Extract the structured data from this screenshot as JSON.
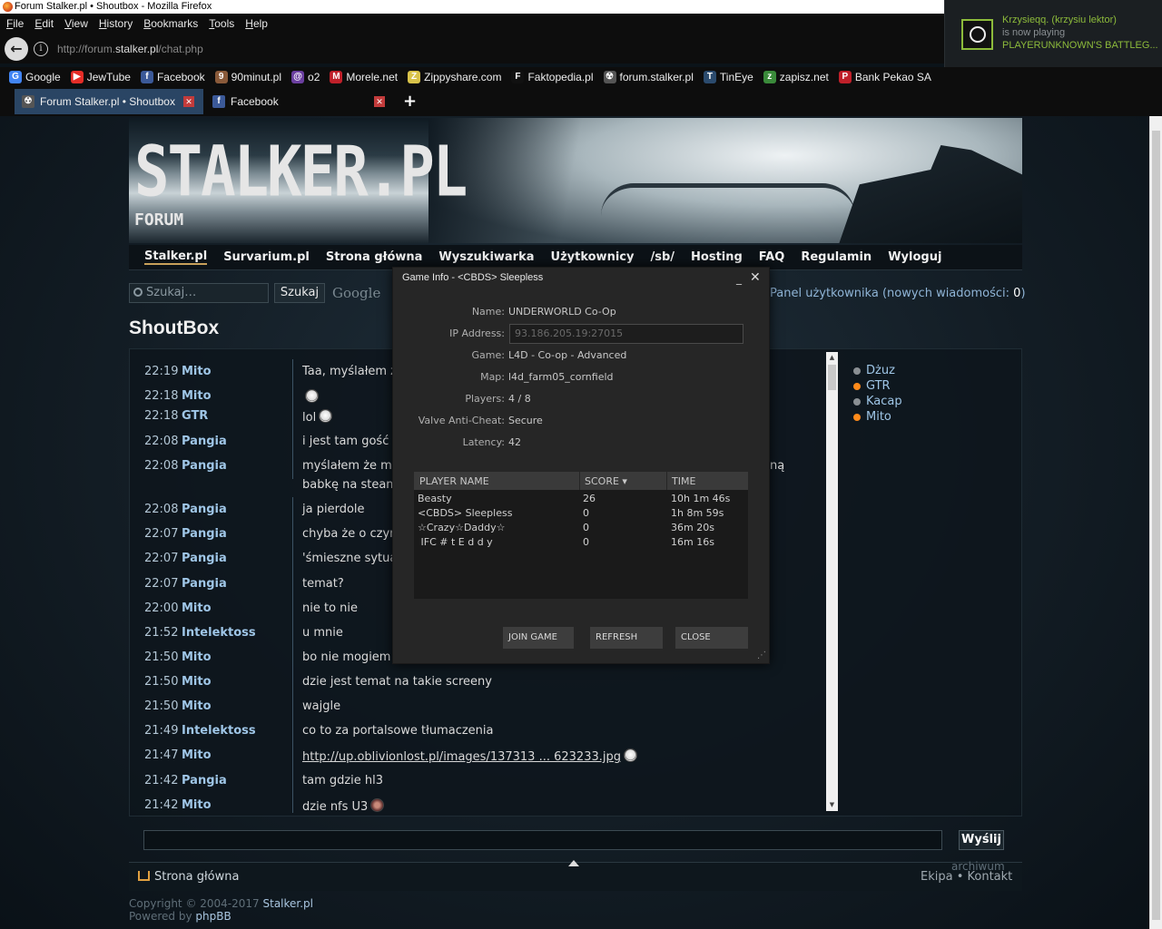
{
  "window": {
    "title": "Forum Stalker.pl • Shoutbox - Mozilla Firefox"
  },
  "menubar": [
    "File",
    "Edit",
    "View",
    "History",
    "Bookmarks",
    "Tools",
    "Help"
  ],
  "address": {
    "prefix": "http://forum.",
    "domain": "stalker.pl",
    "path": "/chat.php"
  },
  "bookmarks": [
    {
      "label": "Google",
      "icon": "google-icon",
      "color": "#4285f4",
      "glyph": "G"
    },
    {
      "label": "JewTube",
      "icon": "youtube-icon",
      "color": "#e52d27",
      "glyph": "▶"
    },
    {
      "label": "Facebook",
      "icon": "facebook-icon",
      "color": "#3b5998",
      "glyph": "f"
    },
    {
      "label": "90minut.pl",
      "icon": "90minut-icon",
      "color": "#8a5a3a",
      "glyph": "9"
    },
    {
      "label": "o2",
      "icon": "o2-icon",
      "color": "#6b3fa0",
      "glyph": "@"
    },
    {
      "label": "Morele.net",
      "icon": "morele-icon",
      "color": "#c0202a",
      "glyph": "M"
    },
    {
      "label": "Zippyshare.com",
      "icon": "zippyshare-icon",
      "color": "#d9c34a",
      "glyph": "Z"
    },
    {
      "label": "Faktopedia.pl",
      "icon": "faktopedia-icon",
      "color": "#111111",
      "glyph": "F"
    },
    {
      "label": "forum.stalker.pl",
      "icon": "radiation-icon",
      "color": "#555555",
      "glyph": "☢"
    },
    {
      "label": "TinEye",
      "icon": "tineye-icon",
      "color": "#2b4b6e",
      "glyph": "T"
    },
    {
      "label": "zapisz.net",
      "icon": "zapisz-icon",
      "color": "#3a8a3a",
      "glyph": "z"
    },
    {
      "label": "Bank Pekao SA",
      "icon": "pekao-icon",
      "color": "#c0202a",
      "glyph": "P"
    }
  ],
  "tabs": [
    {
      "label": "Forum Stalker.pl • Shoutbox",
      "icon": "radiation-icon"
    },
    {
      "label": "Facebook",
      "icon": "facebook-icon"
    }
  ],
  "site": {
    "logo": "STALKER.PL",
    "logo_sub": "FORUM",
    "nav": [
      "Stalker.pl",
      "Survarium.pl",
      "Strona główna",
      "Wyszukiwarka",
      "Użytkownicy",
      "/sb/",
      "Hosting",
      "FAQ",
      "Regulamin",
      "Wyloguj"
    ],
    "search_placeholder": "Szukaj…",
    "search_button": "Szukaj",
    "google": "Google",
    "panel_text": "Panel użytkownika (nowych wiadomości: ",
    "panel_count": "0",
    "panel_end": ")",
    "heading": "ShoutBox"
  },
  "shoutbox": {
    "messages": [
      {
        "time": "22:19",
        "user": "Mito",
        "text": "Taa, myślałem ż",
        "smiley": false
      },
      {
        "time": "22:18",
        "user": "Mito",
        "text": "",
        "smiley": true
      },
      {
        "time": "22:18",
        "user": "GTR",
        "text": "lol",
        "smiley": true
      },
      {
        "time": "22:08",
        "user": "Pangia",
        "text": "i jest tam gość c",
        "smiley": false
      },
      {
        "time": "22:08",
        "user": "Pangia",
        "text": "myślałem że mó",
        "text2": "babkę na steam",
        "tail": "ną",
        "smiley": false
      },
      {
        "time": "22:08",
        "user": "Pangia",
        "text": "ja pierdole",
        "smiley": false
      },
      {
        "time": "22:07",
        "user": "Pangia",
        "text": "chyba że o czym",
        "smiley": false
      },
      {
        "time": "22:07",
        "user": "Pangia",
        "text": "'śmieszne sytua",
        "smiley": false
      },
      {
        "time": "22:07",
        "user": "Pangia",
        "text": "temat?",
        "smiley": false
      },
      {
        "time": "22:00",
        "user": "Mito",
        "text": "nie to nie",
        "smiley": false
      },
      {
        "time": "21:52",
        "user": "Intelektoss",
        "text": "u mnie",
        "smiley": false
      },
      {
        "time": "21:50",
        "user": "Mito",
        "text": "bo nie mogiem z",
        "smiley": false
      },
      {
        "time": "21:50",
        "user": "Mito",
        "text": "dzie jest temat na takie screeny",
        "smiley": false
      },
      {
        "time": "21:50",
        "user": "Mito",
        "text": "wajgle",
        "smiley": false
      },
      {
        "time": "21:49",
        "user": "Intelektoss",
        "text": "co to za portalsowe tłumaczenia",
        "smiley": false
      },
      {
        "time": "21:47",
        "user": "Mito",
        "link": "http://up.oblivionlost.pl/images/137313 ... 623233.jpg",
        "smiley": true
      },
      {
        "time": "21:42",
        "user": "Pangia",
        "text": "tam gdzie hl3",
        "smiley": false
      },
      {
        "time": "21:42",
        "user": "Mito",
        "text": "dzie nfs U3",
        "avatar": true
      }
    ],
    "online_users": [
      {
        "name": "Dżuz",
        "status_color": "#8a8f93"
      },
      {
        "name": "GTR",
        "status_color": "#ff8a1a"
      },
      {
        "name": "Kacap",
        "status_color": "#8a8f93"
      },
      {
        "name": "Mito",
        "status_color": "#ff8a1a"
      }
    ],
    "send_button": "Wyślij",
    "home_link": "Strona główna",
    "archive": "archiwum",
    "footer_right_a": "Ekipa",
    "footer_dot": " • ",
    "footer_right_b": "Kontakt",
    "copyright": "Copyright © 2004-2017 ",
    "copyright_link": "Stalker.pl",
    "powered": "Powered by ",
    "powered_link": "phpBB"
  },
  "dialog": {
    "title": "Game Info - <CBDS> Sleepless",
    "fields": [
      {
        "label": "Name:",
        "value": "UNDERWORLD Co-Op"
      },
      {
        "label": "IP Address:",
        "value": "93.186.205.19:27015"
      },
      {
        "label": "Game:",
        "value": "L4D - Co-op - Advanced"
      },
      {
        "label": "Map:",
        "value": "l4d_farm05_cornfield"
      },
      {
        "label": "Players:",
        "value": "4 / 8"
      },
      {
        "label": "Valve Anti-Cheat:",
        "value": "Secure"
      },
      {
        "label": "Latency:",
        "value": "42"
      }
    ],
    "columns": [
      "PLAYER NAME",
      "SCORE ▾",
      "TIME"
    ],
    "players": [
      {
        "name": "Beasty",
        "score": "26",
        "time": "10h 1m 46s"
      },
      {
        "name": "<CBDS> Sleepless",
        "score": "0",
        "time": "1h 8m 59s"
      },
      {
        "name": "☆Crazy☆Daddy☆",
        "score": "0",
        "time": "36m 20s"
      },
      {
        "name": " IFC # t E d d y",
        "score": "0",
        "time": "16m 16s"
      }
    ],
    "buttons": [
      "JOIN GAME",
      "REFRESH",
      "CLOSE"
    ]
  },
  "notification": {
    "line1": "Krzysieqq. (krzysiu lektor)",
    "line2": "is now playing",
    "line3": "PLAYERUNKNOWN'S BATTLEG..."
  }
}
